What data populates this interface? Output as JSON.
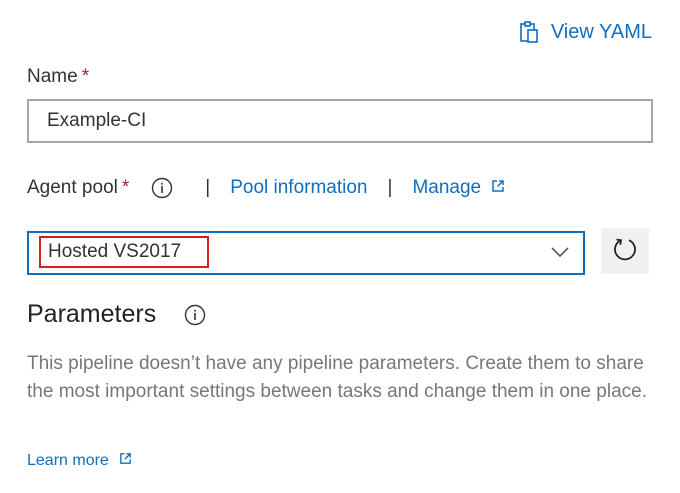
{
  "header": {
    "view_yaml_label": "View YAML",
    "view_yaml_icon": "clipboard-icon"
  },
  "name_field": {
    "label": "Name",
    "required_mark": "*",
    "value": "Example-CI"
  },
  "agent_pool": {
    "label": "Agent pool",
    "required_mark": "*",
    "separator": "|",
    "pool_information_link": "Pool information",
    "manage_link": "Manage",
    "selected_value": "Hosted VS2017",
    "refresh_icon": "refresh-icon"
  },
  "parameters": {
    "title": "Parameters",
    "description": "This pipeline doesn’t have any pipeline parameters. Create them to share the most important settings between tasks and change them in one place.",
    "learn_more_link": "Learn more"
  },
  "colors": {
    "link": "#106ebe",
    "required": "#a4262c",
    "highlight_box": "#d51f1f",
    "select_border": "#106ebe",
    "muted_text": "#777777"
  }
}
